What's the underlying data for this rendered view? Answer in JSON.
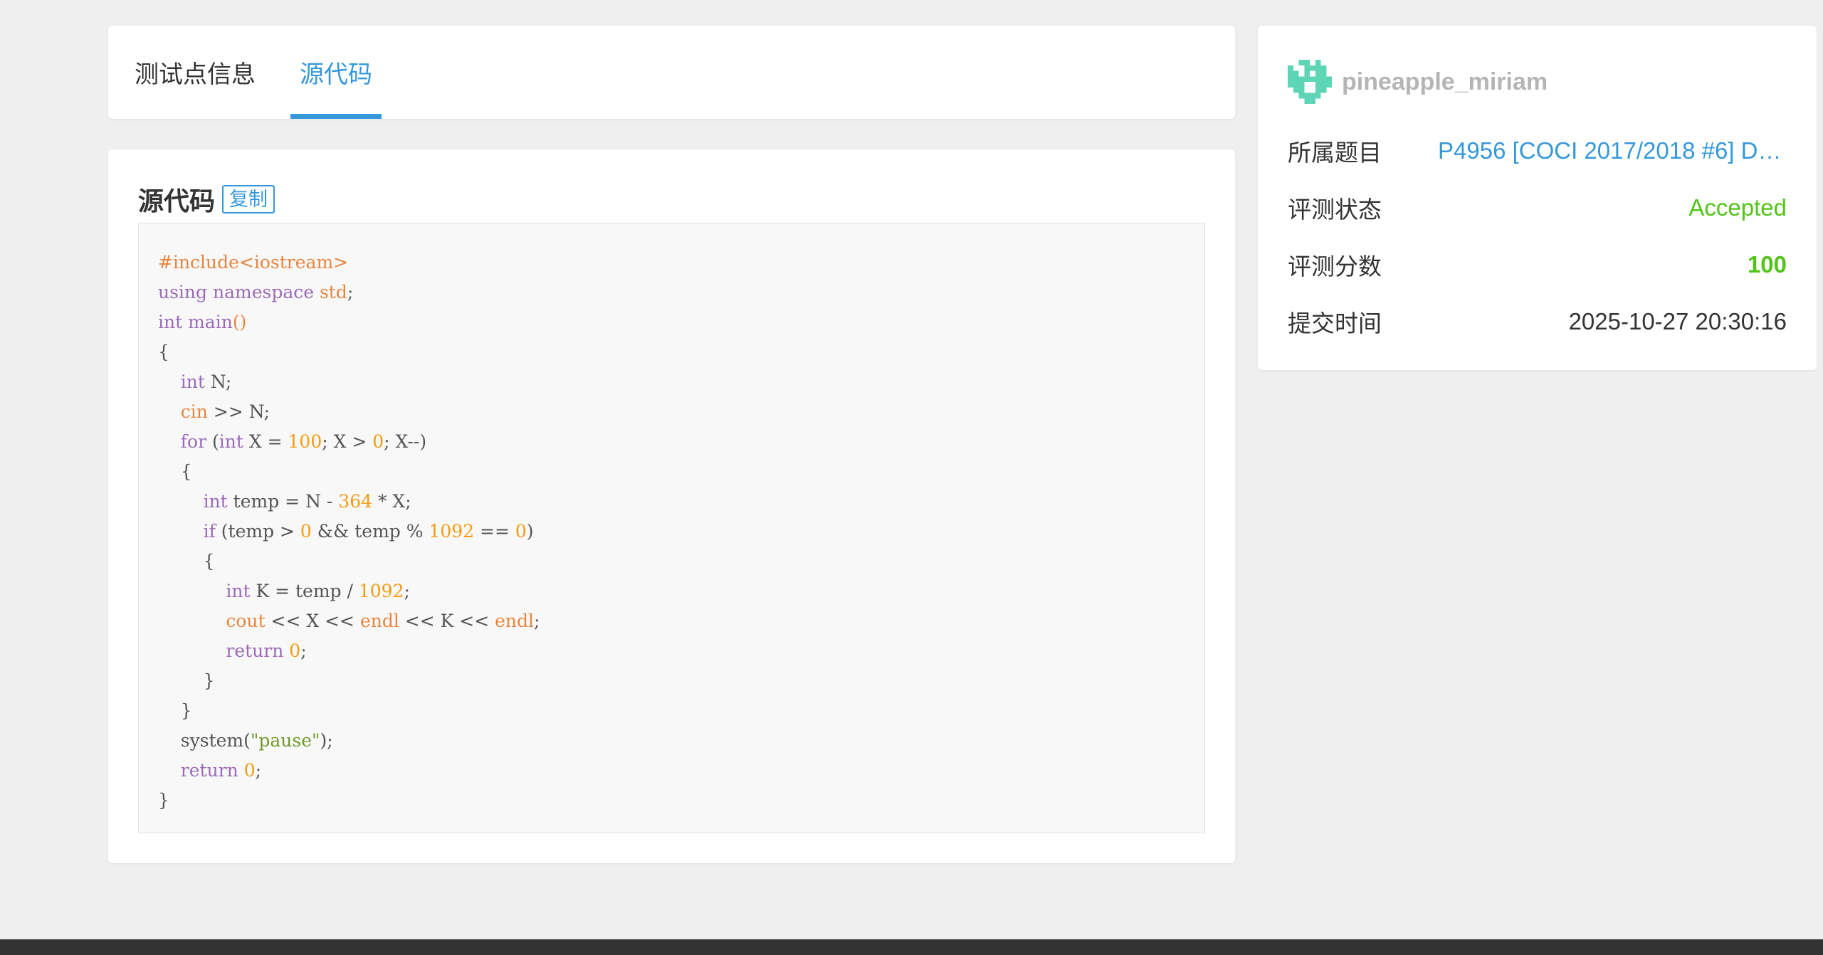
{
  "tabs": [
    {
      "label": "测试点信息"
    },
    {
      "label": "源代码"
    }
  ],
  "code_panel": {
    "title": "源代码",
    "copy_label": "复制",
    "lines": [
      [
        {
          "t": "#include<iostream>",
          "c": "c-pre"
        }
      ],
      [
        {
          "t": "using namespace ",
          "c": "c-kw"
        },
        {
          "t": "std",
          "c": "c-ora"
        },
        {
          "t": ";",
          "c": "c-op"
        }
      ],
      [
        {
          "t": "int ",
          "c": "c-kw"
        },
        {
          "t": "main",
          "c": "c-kw"
        },
        {
          "t": "()",
          "c": "c-ora"
        }
      ],
      [
        {
          "t": "{",
          "c": "c-op"
        }
      ],
      [
        {
          "t": "    ",
          "c": "c-op"
        },
        {
          "t": "int ",
          "c": "c-kw"
        },
        {
          "t": "N;",
          "c": "c-op"
        }
      ],
      [
        {
          "t": "    ",
          "c": "c-op"
        },
        {
          "t": "cin",
          "c": "c-ora"
        },
        {
          "t": " >> N;",
          "c": "c-op"
        }
      ],
      [
        {
          "t": "    ",
          "c": "c-op"
        },
        {
          "t": "for",
          "c": "c-kw"
        },
        {
          "t": " (",
          "c": "c-op"
        },
        {
          "t": "int",
          "c": "c-kw"
        },
        {
          "t": " X = ",
          "c": "c-op"
        },
        {
          "t": "100",
          "c": "c-num"
        },
        {
          "t": "; X > ",
          "c": "c-op"
        },
        {
          "t": "0",
          "c": "c-num"
        },
        {
          "t": "; X--)",
          "c": "c-op"
        }
      ],
      [
        {
          "t": "    {",
          "c": "c-op"
        }
      ],
      [
        {
          "t": "        ",
          "c": "c-op"
        },
        {
          "t": "int",
          "c": "c-kw"
        },
        {
          "t": " temp = N - ",
          "c": "c-op"
        },
        {
          "t": "364",
          "c": "c-num"
        },
        {
          "t": " * X;",
          "c": "c-op"
        }
      ],
      [
        {
          "t": "        ",
          "c": "c-op"
        },
        {
          "t": "if",
          "c": "c-kw"
        },
        {
          "t": " (temp > ",
          "c": "c-op"
        },
        {
          "t": "0",
          "c": "c-num"
        },
        {
          "t": " && temp % ",
          "c": "c-op"
        },
        {
          "t": "1092",
          "c": "c-num"
        },
        {
          "t": " == ",
          "c": "c-op"
        },
        {
          "t": "0",
          "c": "c-num"
        },
        {
          "t": ")",
          "c": "c-op"
        }
      ],
      [
        {
          "t": "        {",
          "c": "c-op"
        }
      ],
      [
        {
          "t": "            ",
          "c": "c-op"
        },
        {
          "t": "int",
          "c": "c-kw"
        },
        {
          "t": " K = temp / ",
          "c": "c-op"
        },
        {
          "t": "1092",
          "c": "c-num"
        },
        {
          "t": ";",
          "c": "c-op"
        }
      ],
      [
        {
          "t": "            ",
          "c": "c-op"
        },
        {
          "t": "cout",
          "c": "c-ora"
        },
        {
          "t": " << X << ",
          "c": "c-op"
        },
        {
          "t": "endl",
          "c": "c-ora"
        },
        {
          "t": " << K << ",
          "c": "c-op"
        },
        {
          "t": "endl",
          "c": "c-ora"
        },
        {
          "t": ";",
          "c": "c-op"
        }
      ],
      [
        {
          "t": "            ",
          "c": "c-op"
        },
        {
          "t": "return",
          "c": "c-kw"
        },
        {
          "t": " ",
          "c": "c-op"
        },
        {
          "t": "0",
          "c": "c-num"
        },
        {
          "t": ";",
          "c": "c-op"
        }
      ],
      [
        {
          "t": "        }",
          "c": "c-op"
        }
      ],
      [
        {
          "t": "    }",
          "c": "c-op"
        }
      ],
      [
        {
          "t": "    system(",
          "c": "c-op"
        },
        {
          "t": "\"pause\"",
          "c": "c-str"
        },
        {
          "t": ");",
          "c": "c-op"
        }
      ],
      [
        {
          "t": "    ",
          "c": "c-op"
        },
        {
          "t": "return",
          "c": "c-kw"
        },
        {
          "t": " ",
          "c": "c-op"
        },
        {
          "t": "0",
          "c": "c-num"
        },
        {
          "t": ";",
          "c": "c-op"
        }
      ],
      [
        {
          "t": "}",
          "c": "c-op"
        }
      ]
    ]
  },
  "submission": {
    "username": "pineapple_miriam",
    "rows": [
      {
        "label": "所属题目",
        "value": "P4956 [COCI 2017/2018 #6] Da..."
      },
      {
        "label": "评测状态",
        "value": "Accepted"
      },
      {
        "label": "评测分数",
        "value": "100"
      },
      {
        "label": "提交时间",
        "value": "2025-10-27 20:30:16"
      }
    ]
  },
  "colors": {
    "accent": "#3498db",
    "accepted": "#52c41a",
    "avatar": "#5ed6b6"
  },
  "icons": {
    "avatar": "pixel-avatar-icon"
  }
}
